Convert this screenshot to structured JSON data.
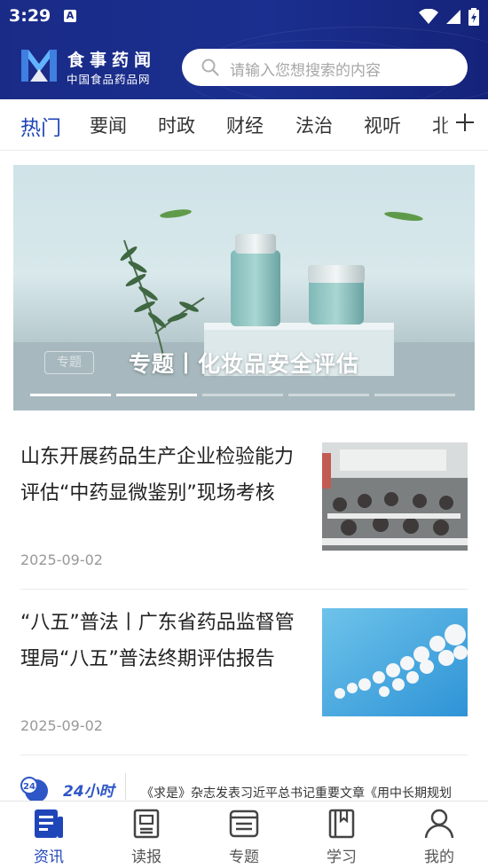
{
  "status_bar": {
    "time": "3:29",
    "notification_icon": "A",
    "icons": [
      "wifi-icon",
      "signal-icon",
      "battery-icon"
    ]
  },
  "header": {
    "brand_name": "食事药闻",
    "brand_sub": "中国食品药品网",
    "search_placeholder": "请输入您想搜索的内容"
  },
  "tabs": [
    {
      "label": "热门",
      "active": true
    },
    {
      "label": "要闻"
    },
    {
      "label": "时政"
    },
    {
      "label": "财经"
    },
    {
      "label": "法治"
    },
    {
      "label": "视听"
    },
    {
      "label": "北"
    }
  ],
  "banner": {
    "tag": "专题",
    "caption": "专题丨化妆品安全评估",
    "slide_count": 5,
    "active_slide": 2
  },
  "news": [
    {
      "title": "山东开展药品生产企业检验能力评估“中药显微鉴别”现场考核",
      "date": "2025-09-02",
      "thumb": "meeting-room-photo"
    },
    {
      "title": "“八五”普法丨广东省药品监督管理局“八五”普法终期评估报告",
      "date": "2025-09-02",
      "thumb": "pills-photo"
    }
  ],
  "ticker": {
    "badge_label": "24小时",
    "text": "《求是》杂志发表习近平总书记重要文章《用中长期规划"
  },
  "bottom_nav": [
    {
      "label": "资讯",
      "icon": "news-icon",
      "active": true
    },
    {
      "label": "读报",
      "icon": "newspaper-icon"
    },
    {
      "label": "专题",
      "icon": "topic-icon"
    },
    {
      "label": "学习",
      "icon": "book-icon"
    },
    {
      "label": "我的",
      "icon": "profile-icon"
    }
  ],
  "colors": {
    "brand_blue": "#1a2b87",
    "accent_blue": "#1f46b8"
  }
}
